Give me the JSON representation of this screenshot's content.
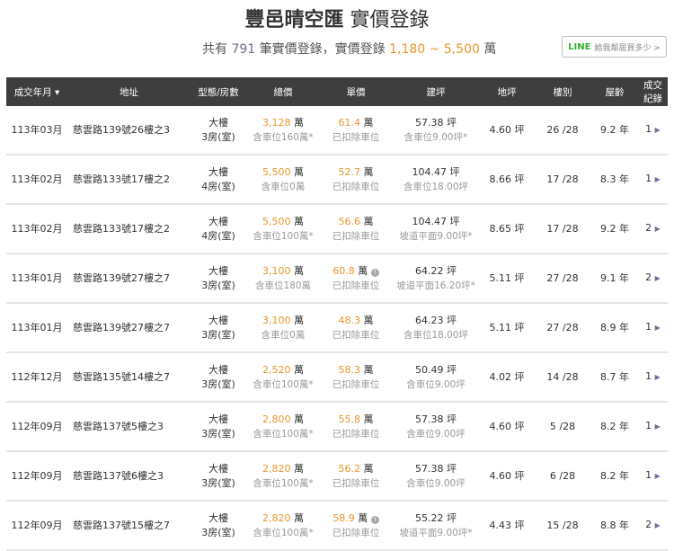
{
  "header": {
    "title_bold": "豐邑晴空匯",
    "title_rest": "實價登錄"
  },
  "summary": {
    "prefix": "共有",
    "count": "791",
    "mid": "筆實價登錄，實價登錄",
    "range": "1,180 ~ 5,500",
    "suffix": "萬"
  },
  "line_button": {
    "brand": "LINE",
    "label": "給我鄰居買多少 >"
  },
  "columns": [
    "成交年月 ▾",
    "地址",
    "型態/房數",
    "總價",
    "單價",
    "建坪",
    "地坪",
    "樓別",
    "屋齡",
    "成交紀錄"
  ],
  "rows": [
    {
      "date": "113年03月",
      "addr": "慈雲路139號26樓之3",
      "type": "大樓",
      "rooms": "3房(室)",
      "total": "3,128",
      "total_sub": "含車位160萬*",
      "unit": "61.4",
      "info": false,
      "unit_sub": "已扣除車位",
      "area": "57.38 坪",
      "area_sub": "含車位9.00坪*",
      "land": "4.60 坪",
      "floor": "26 /28",
      "age": "9.2 年",
      "rec": "1"
    },
    {
      "date": "113年02月",
      "addr": "慈雲路133號17樓之2",
      "type": "大樓",
      "rooms": "4房(室)",
      "total": "5,500",
      "total_sub": "含車位0萬",
      "unit": "52.7",
      "info": false,
      "unit_sub": "已扣除車位",
      "area": "104.47 坪",
      "area_sub": "含車位18.00坪",
      "land": "8.66 坪",
      "floor": "17 /28",
      "age": "8.3 年",
      "rec": "1"
    },
    {
      "date": "113年02月",
      "addr": "慈雲路133號17樓之2",
      "type": "大樓",
      "rooms": "4房(室)",
      "total": "5,500",
      "total_sub": "含車位100萬*",
      "unit": "56.6",
      "info": false,
      "unit_sub": "已扣除車位",
      "area": "104.47 坪",
      "area_sub": "坡道平面9.00坪*",
      "land": "8.65 坪",
      "floor": "17 /28",
      "age": "9.2 年",
      "rec": "2"
    },
    {
      "date": "113年01月",
      "addr": "慈雲路139號27樓之7",
      "type": "大樓",
      "rooms": "3房(室)",
      "total": "3,100",
      "total_sub": "含車位180萬",
      "unit": "60.8",
      "info": true,
      "unit_sub": "已扣除車位",
      "area": "64.22 坪",
      "area_sub": "坡道平面16.20坪*",
      "land": "5.11 坪",
      "floor": "27 /28",
      "age": "9.1 年",
      "rec": "2"
    },
    {
      "date": "113年01月",
      "addr": "慈雲路139號27樓之7",
      "type": "大樓",
      "rooms": "3房(室)",
      "total": "3,100",
      "total_sub": "含車位0萬",
      "unit": "48.3",
      "info": false,
      "unit_sub": "已扣除車位",
      "area": "64.23 坪",
      "area_sub": "含車位18.00坪",
      "land": "5.11 坪",
      "floor": "27 /28",
      "age": "8.9 年",
      "rec": "1"
    },
    {
      "date": "112年12月",
      "addr": "慈雲路135號14樓之7",
      "type": "大樓",
      "rooms": "3房(室)",
      "total": "2,520",
      "total_sub": "含車位100萬*",
      "unit": "58.3",
      "info": false,
      "unit_sub": "已扣除車位",
      "area": "50.49 坪",
      "area_sub": "含車位9.00坪",
      "land": "4.02 坪",
      "floor": "14 /28",
      "age": "8.7 年",
      "rec": "1"
    },
    {
      "date": "112年09月",
      "addr": "慈雲路137號5樓之3",
      "type": "大樓",
      "rooms": "3房(室)",
      "total": "2,800",
      "total_sub": "含車位100萬*",
      "unit": "55.8",
      "info": false,
      "unit_sub": "已扣除車位",
      "area": "57.38 坪",
      "area_sub": "含車位9.00坪",
      "land": "4.60 坪",
      "floor": "5 /28",
      "age": "8.2 年",
      "rec": "1"
    },
    {
      "date": "112年09月",
      "addr": "慈雲路137號6樓之3",
      "type": "大樓",
      "rooms": "3房(室)",
      "total": "2,820",
      "total_sub": "含車位100萬*",
      "unit": "56.2",
      "info": false,
      "unit_sub": "已扣除車位",
      "area": "57.38 坪",
      "area_sub": "含車位9.00坪",
      "land": "4.60 坪",
      "floor": "6 /28",
      "age": "8.2 年",
      "rec": "1"
    },
    {
      "date": "112年09月",
      "addr": "慈雲路137號15樓之7",
      "type": "大樓",
      "rooms": "3房(室)",
      "total": "2,820",
      "total_sub": "含車位100萬*",
      "unit": "58.9",
      "info": true,
      "unit_sub": "已扣除車位",
      "area": "55.22 坪",
      "area_sub": "坡道平面9.00坪*",
      "land": "4.43 坪",
      "floor": "15 /28",
      "age": "8.8 年",
      "rec": "2"
    }
  ],
  "unit_word": "萬"
}
